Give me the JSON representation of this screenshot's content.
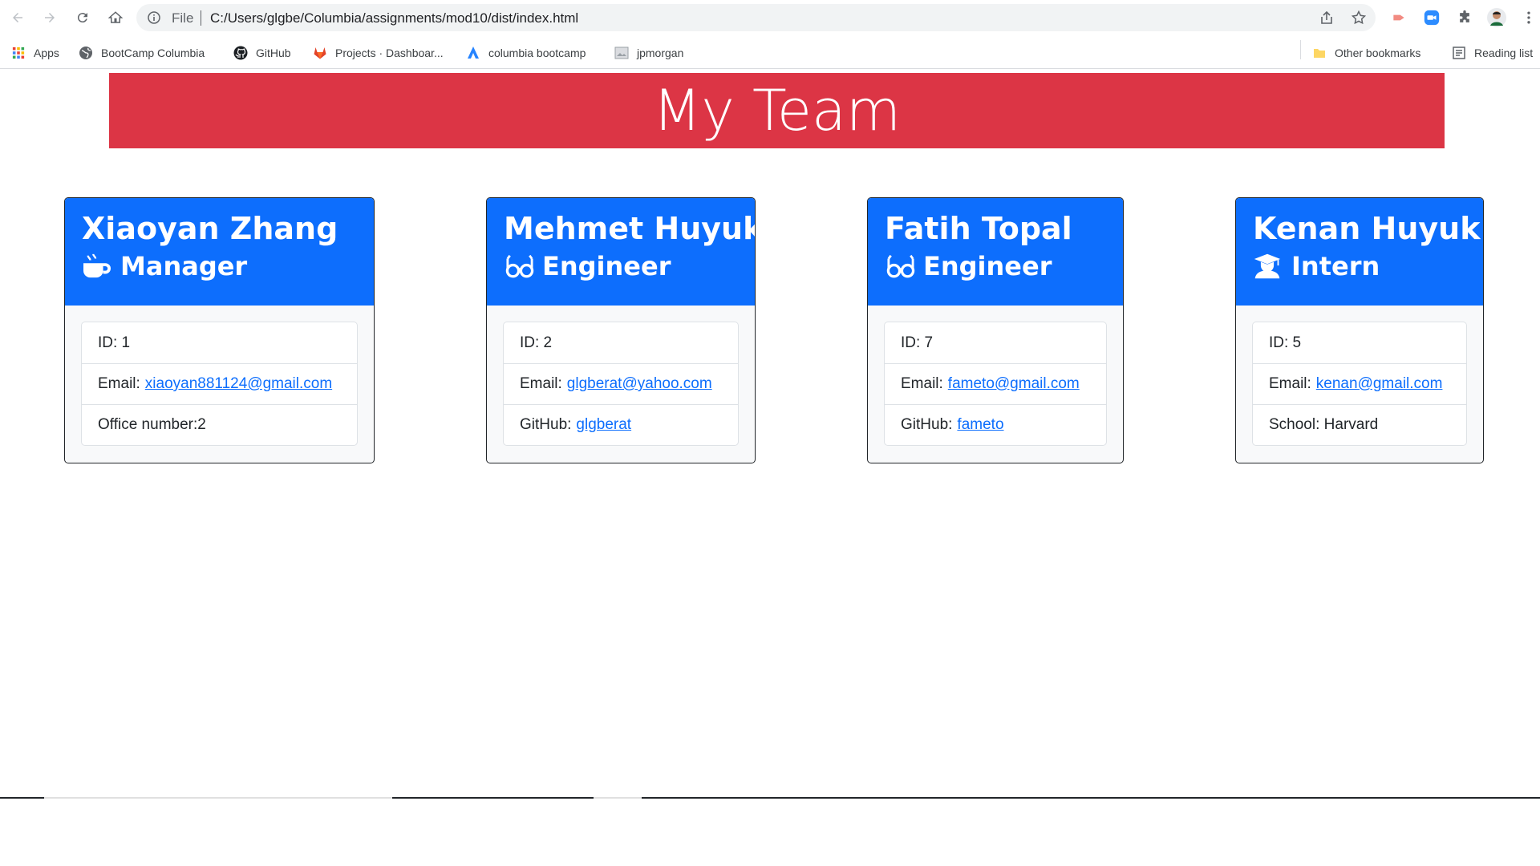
{
  "browser": {
    "omnibox": {
      "scheme_label": "File",
      "url": "C:/Users/glgbe/Columbia/assignments/mod10/dist/index.html"
    },
    "bookmarks": [
      {
        "label": "Apps",
        "icon": "apps-grid-icon"
      },
      {
        "label": "BootCamp Columbia",
        "icon": "globe-icon"
      },
      {
        "label": "GitHub",
        "icon": "github-icon"
      },
      {
        "label": "Projects · Dashboar...",
        "icon": "gitlab-icon"
      },
      {
        "label": "columbia bootcamp",
        "icon": "atlassian-icon"
      },
      {
        "label": "jpmorgan",
        "icon": "image-icon"
      }
    ],
    "other_bookmarks": "Other bookmarks",
    "reading_list": "Reading list"
  },
  "page": {
    "title": "My Team",
    "colors": {
      "header": "#dc3545",
      "card_header": "#0d6efd",
      "link": "#0d6efd"
    }
  },
  "team": [
    {
      "name": "Xiaoyan Zhang",
      "role": "Manager",
      "role_icon": "mug-icon",
      "id_text": "ID: 1",
      "email_label": "Email:",
      "email": "xiaoyan881124@gmail.com",
      "extra_label": "Office number:2",
      "extra_link": ""
    },
    {
      "name": "Mehmet Huyuk",
      "role": "Engineer",
      "role_icon": "glasses-icon",
      "id_text": "ID: 2",
      "email_label": "Email:",
      "email": "glgberat@yahoo.com",
      "extra_label": "GitHub:",
      "extra_link": "glgberat"
    },
    {
      "name": "Fatih Topal",
      "role": "Engineer",
      "role_icon": "glasses-icon",
      "id_text": "ID: 7",
      "email_label": "Email:",
      "email": "fameto@gmail.com",
      "extra_label": "GitHub:",
      "extra_link": "fameto"
    },
    {
      "name": "Kenan Huyuk",
      "role": "Intern",
      "role_icon": "graduate-icon",
      "id_text": "ID: 5",
      "email_label": "Email:",
      "email": "kenan@gmail.com",
      "extra_label": "School: Harvard",
      "extra_link": ""
    }
  ]
}
